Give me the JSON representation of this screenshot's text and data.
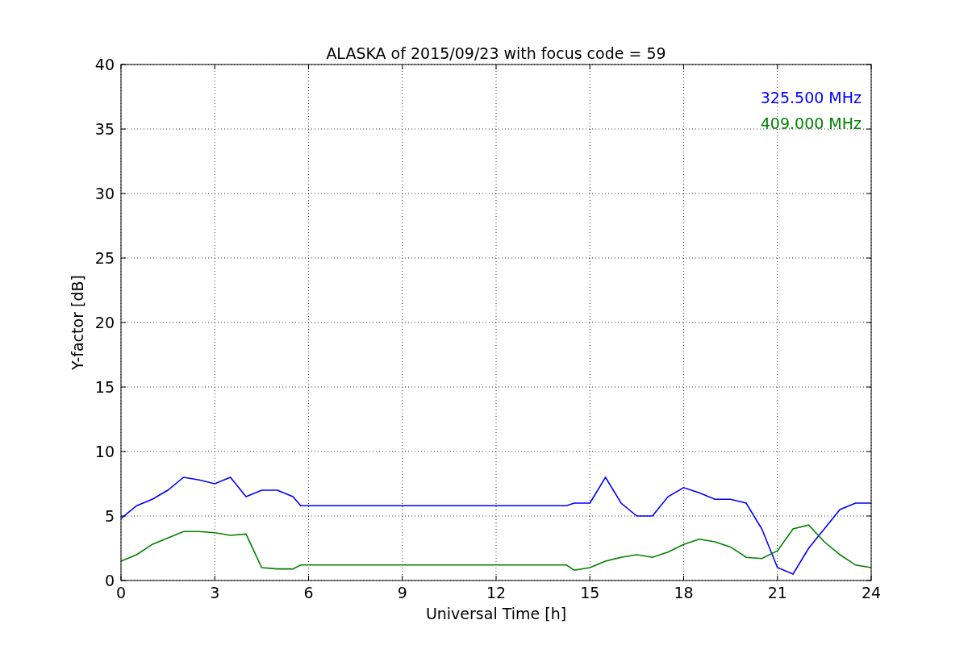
{
  "chart_data": {
    "type": "line",
    "title": "ALASKA of 2015/09/23 with focus code = 59",
    "xlabel": "Universal Time [h]",
    "ylabel": "Y-factor [dB]",
    "x": [
      0,
      0.5,
      1,
      1.5,
      2,
      2.5,
      3,
      3.5,
      4,
      4.5,
      5,
      5.5,
      5.75,
      14.25,
      14.5,
      15,
      15.5,
      16,
      16.5,
      17,
      17.5,
      18,
      18.5,
      19,
      19.5,
      20,
      20.5,
      21,
      21.5,
      22,
      22.5,
      23,
      23.5,
      24
    ],
    "series": [
      {
        "name": "325.500 MHz",
        "color": "#0000ff",
        "values": [
          4.8,
          5.8,
          6.3,
          7.0,
          8.0,
          7.8,
          7.5,
          8.0,
          6.5,
          7.0,
          7.0,
          6.5,
          5.8,
          5.8,
          6.0,
          6.0,
          8.0,
          6.0,
          5.0,
          5.0,
          6.5,
          7.2,
          6.8,
          6.3,
          6.3,
          6.0,
          4.0,
          1.0,
          0.5,
          2.5,
          4.0,
          5.5,
          6.0,
          6.0
        ]
      },
      {
        "name": "409.000 MHz",
        "color": "#008000",
        "values": [
          1.5,
          2.0,
          2.8,
          3.3,
          3.8,
          3.8,
          3.7,
          3.5,
          3.6,
          1.0,
          0.9,
          0.9,
          1.2,
          1.2,
          0.8,
          1.0,
          1.5,
          1.8,
          2.0,
          1.8,
          2.2,
          2.8,
          3.2,
          3.0,
          2.6,
          1.8,
          1.7,
          2.3,
          4.0,
          4.3,
          3.0,
          2.0,
          1.2,
          1.0
        ]
      }
    ],
    "grid": true,
    "xlim": [
      0,
      24
    ],
    "ylim": [
      0,
      40
    ],
    "xticks": [
      0,
      3,
      6,
      9,
      12,
      15,
      18,
      21,
      24
    ],
    "yticks": [
      0,
      5,
      10,
      15,
      20,
      25,
      30,
      35,
      40
    ]
  }
}
